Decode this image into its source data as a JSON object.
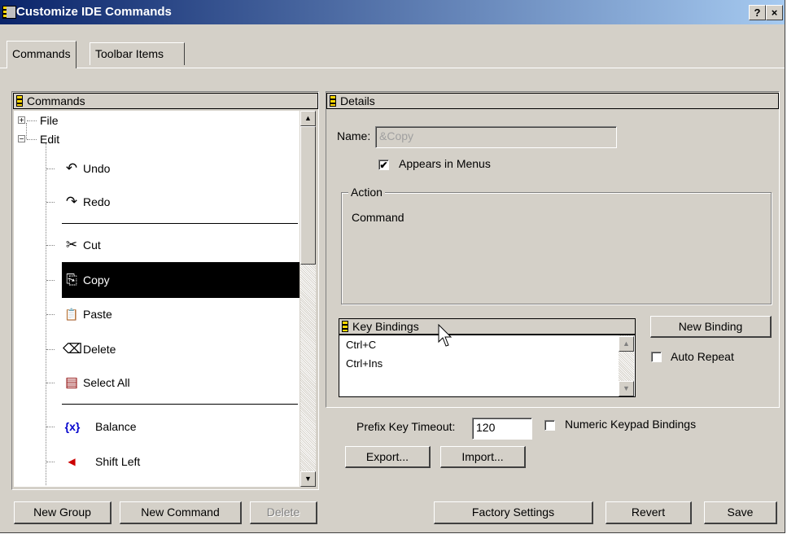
{
  "window": {
    "title": "Customize IDE Commands",
    "help_label": "?",
    "close_label": "×"
  },
  "tabs": [
    {
      "label": "Commands"
    },
    {
      "label": "Toolbar Items"
    }
  ],
  "commands_panel": {
    "header": "Commands",
    "tree": [
      {
        "label": "File",
        "expander": "+"
      },
      {
        "label": "Edit",
        "expander": "−"
      },
      {
        "label": "Undo",
        "icon": "undo-icon",
        "glyph": "↶"
      },
      {
        "label": "Redo",
        "icon": "redo-icon",
        "glyph": "↷"
      },
      {
        "label": "Cut",
        "icon": "scissors-icon",
        "glyph": "✂"
      },
      {
        "label": "Copy",
        "icon": "copy-icon",
        "glyph": "⎘",
        "selected": true
      },
      {
        "label": "Paste",
        "icon": "paste-icon",
        "glyph": "📋"
      },
      {
        "label": "Delete",
        "icon": "delete-icon",
        "glyph": "⌫"
      },
      {
        "label": "Select All",
        "icon": "select-all-icon",
        "glyph": "▤"
      },
      {
        "label": "Balance",
        "icon": "balance-icon",
        "glyph": "{x}"
      },
      {
        "label": "Shift Left",
        "icon": "shift-left-icon",
        "glyph": "◀"
      }
    ]
  },
  "details": {
    "header": "Details",
    "name_label": "Name:",
    "name_value": "&Copy",
    "appears_in_menus_label": "Appears in Menus",
    "appears_in_menus_checked": true,
    "action_group_label": "Action",
    "action_value": "Command",
    "key_bindings_header": "Key Bindings",
    "key_bindings": [
      "Ctrl+C",
      "Ctrl+Ins"
    ],
    "new_binding_label": "New Binding",
    "auto_repeat_label": "Auto Repeat",
    "auto_repeat_checked": false
  },
  "prefix": {
    "label": "Prefix Key Timeout:",
    "value": "120",
    "numeric_keypad_label": "Numeric Keypad Bindings",
    "numeric_keypad_checked": false
  },
  "buttons": {
    "export": "Export...",
    "import": "Import...",
    "new_group": "New Group",
    "new_command": "New Command",
    "delete": "Delete",
    "factory_settings": "Factory Settings",
    "revert": "Revert",
    "save": "Save"
  },
  "colors": {
    "title_bar": "#0a246a",
    "face": "#d4d0c8",
    "selection": "#000000"
  }
}
